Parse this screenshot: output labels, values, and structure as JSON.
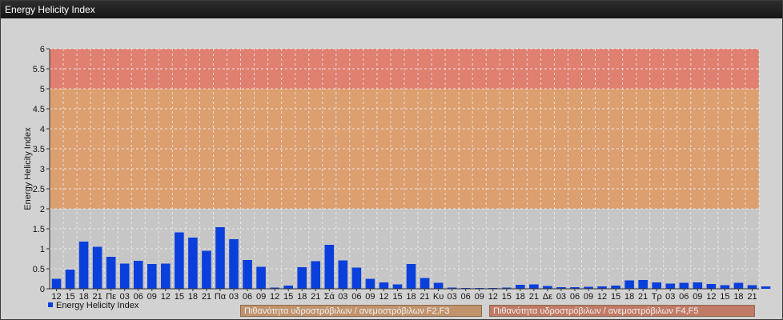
{
  "window": {
    "title": "Energy Helicity Index"
  },
  "colors": {
    "bar": "#0b3fdb",
    "zone_low": "#c6c6c6",
    "zone_mid": "#dc9f70",
    "zone_high": "#df8070",
    "grid": "#f2f2f2"
  },
  "chart_data": {
    "type": "bar",
    "ylabel": "Energy Helicity Index",
    "ylim": [
      0,
      6
    ],
    "yticks": [
      "0",
      "0.5",
      "1",
      "1.5",
      "2",
      "2.5",
      "3",
      "3.5",
      "4",
      "4.5",
      "5",
      "5.5",
      "6"
    ],
    "grid": true,
    "zones": [
      {
        "from": 0,
        "to": 2,
        "color": "#c6c6c6"
      },
      {
        "from": 2,
        "to": 5,
        "color": "#dc9f70"
      },
      {
        "from": 5,
        "to": 6,
        "color": "#df8070"
      }
    ],
    "categories": [
      "12",
      "15",
      "18",
      "21",
      "Πε",
      "03",
      "06",
      "09",
      "12",
      "15",
      "18",
      "21",
      "Πα",
      "03",
      "06",
      "09",
      "12",
      "15",
      "18",
      "21",
      "Σά",
      "03",
      "06",
      "09",
      "12",
      "15",
      "18",
      "21",
      "Κυ",
      "03",
      "06",
      "09",
      "12",
      "15",
      "18",
      "21",
      "Δε",
      "03",
      "06",
      "09",
      "12",
      "15",
      "18",
      "21",
      "Τρ",
      "03",
      "06",
      "09",
      "12",
      "15",
      "18",
      "21"
    ],
    "series": [
      {
        "name": "Energy Helicity Index",
        "values": [
          0.25,
          0.48,
          1.18,
          1.05,
          0.8,
          0.63,
          0.7,
          0.62,
          0.63,
          1.41,
          1.28,
          0.95,
          1.54,
          1.24,
          0.72,
          0.55,
          0.03,
          0.08,
          0.54,
          0.69,
          1.1,
          0.71,
          0.53,
          0.25,
          0.16,
          0.11,
          0.62,
          0.27,
          0.15,
          0.03,
          0.02,
          0.02,
          0.02,
          0.03,
          0.1,
          0.11,
          0.07,
          0.04,
          0.04,
          0.05,
          0.06,
          0.08,
          0.21,
          0.22,
          0.16,
          0.13,
          0.15,
          0.16,
          0.12,
          0.09,
          0.15,
          0.09,
          0.06
        ]
      }
    ],
    "legend": {
      "series_label": "Energy Helicity Index",
      "zone_labels": [
        "Πιθανότητα υδροστρόβιλων / ανεμοστρόβιλων F2,F3",
        "Πιθανότητα υδροστρόβιλων / ανεμοστρόβιλων F4,F5"
      ]
    }
  }
}
